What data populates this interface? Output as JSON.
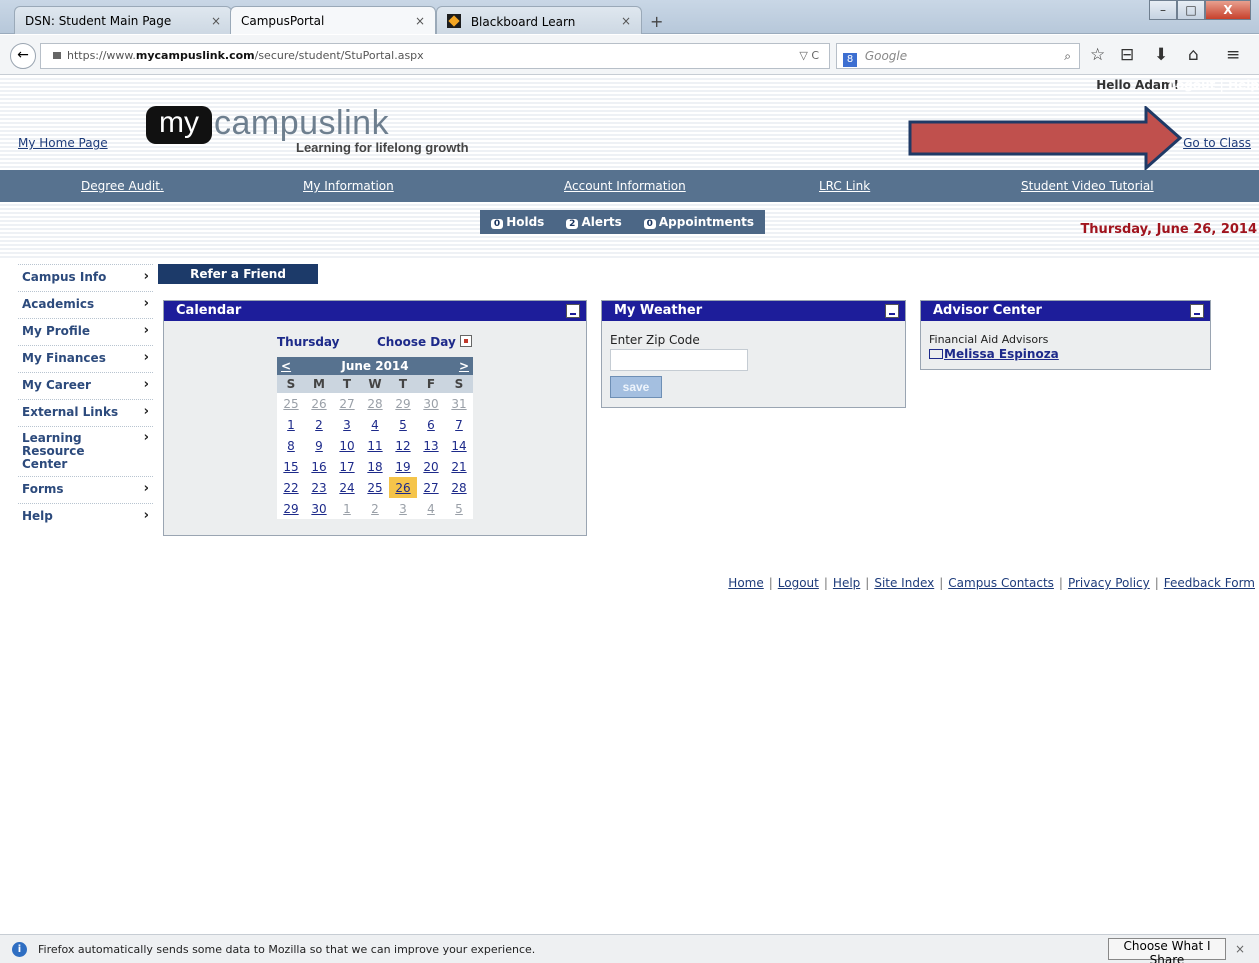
{
  "browser": {
    "tabs": [
      {
        "label": "DSN: Student Main Page"
      },
      {
        "label": "CampusPortal"
      },
      {
        "label": "Blackboard Learn"
      }
    ],
    "tab_close": "×",
    "new_tab": "+",
    "window_controls": {
      "min": "–",
      "max": "□",
      "close": "X"
    },
    "back": "←",
    "url_prefix": "https://www.",
    "url_domain": "mycampuslink.com",
    "url_path": "/secure/student/StuPortal.aspx",
    "url_tools": "▽ C",
    "search_engine": "8",
    "search_placeholder": "Google",
    "search_icon": "⌕",
    "toolbar_icons": [
      "☆",
      "⊟",
      "⬇",
      "⌂",
      "≡"
    ]
  },
  "header": {
    "hello": "Hello Adam!",
    "hello_links": "Logout | Help",
    "my_home": "My Home Page",
    "logo_my": "my",
    "logo_campuslink": "campuslink",
    "tagline": "Learning for lifelong growth",
    "go_to_class": "Go to Class",
    "arrow_color": "#c0504d"
  },
  "mainnav": [
    {
      "label": "Degree Audit."
    },
    {
      "label": "My Information"
    },
    {
      "label": "Account Information"
    },
    {
      "label": "LRC Link"
    },
    {
      "label": "Student Video Tutorial"
    }
  ],
  "alerts": {
    "holds": {
      "count": "0",
      "label": "Holds"
    },
    "alerts": {
      "count": "2",
      "label": "Alerts"
    },
    "appointments": {
      "count": "0",
      "label": "Appointments"
    }
  },
  "date_display": "Thursday, June 26, 2014",
  "sidebar": {
    "items": [
      {
        "label": "Campus Info"
      },
      {
        "label": "Academics"
      },
      {
        "label": "My Profile"
      },
      {
        "label": "My Finances"
      },
      {
        "label": "My Career"
      },
      {
        "label": "External Links"
      },
      {
        "label": "Learning Resource Center"
      },
      {
        "label": "Forms"
      },
      {
        "label": "Help"
      }
    ],
    "chevron": "›"
  },
  "refer_friend": "Refer a Friend",
  "calendar": {
    "title": "Calendar",
    "day_name": "Thursday",
    "choose_day": "Choose Day",
    "prev": "<",
    "next": ">",
    "month": "June 2014",
    "weekdays": [
      "S",
      "M",
      "T",
      "W",
      "T",
      "F",
      "S"
    ],
    "weeks": [
      [
        "25",
        "26",
        "27",
        "28",
        "29",
        "30",
        "31"
      ],
      [
        "1",
        "2",
        "3",
        "4",
        "5",
        "6",
        "7"
      ],
      [
        "8",
        "9",
        "10",
        "11",
        "12",
        "13",
        "14"
      ],
      [
        "15",
        "16",
        "17",
        "18",
        "19",
        "20",
        "21"
      ],
      [
        "22",
        "23",
        "24",
        "25",
        "26",
        "27",
        "28"
      ],
      [
        "29",
        "30",
        "1",
        "2",
        "3",
        "4",
        "5"
      ]
    ],
    "today": "26",
    "today_color": "#f5c44a"
  },
  "weather": {
    "title": "My Weather",
    "label": "Enter Zip Code",
    "input_value": "",
    "save": "save"
  },
  "advisor": {
    "title": "Advisor Center",
    "label": "Financial Aid Advisors",
    "name": "Melissa Espinoza"
  },
  "footer_links": [
    "Home",
    "Logout",
    "Help",
    "Site Index",
    "Campus Contacts",
    "Privacy Policy",
    "Feedback Form"
  ],
  "notification": {
    "icon": "i",
    "text": "Firefox automatically sends some data to Mozilla so that we can improve your experience.",
    "button": "Choose What I Share",
    "close": "×"
  }
}
